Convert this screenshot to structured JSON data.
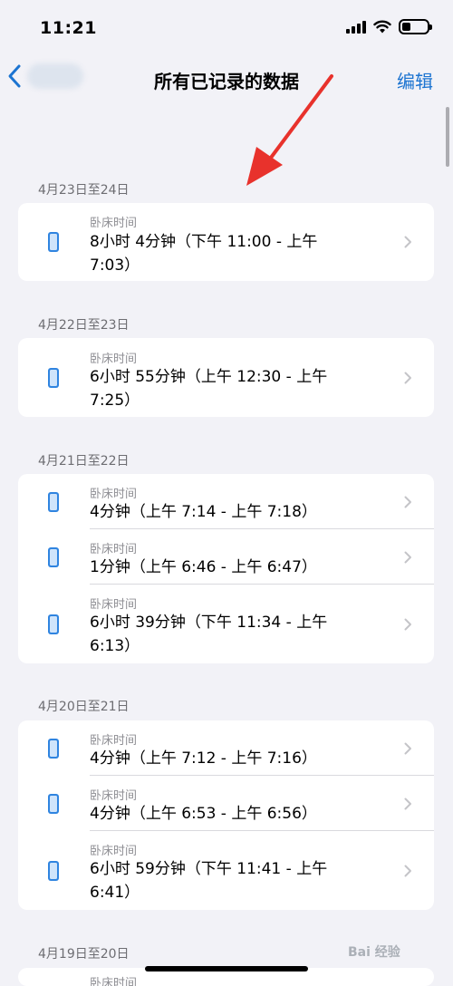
{
  "status_bar": {
    "time": "11:21",
    "battery_level": 0.35
  },
  "nav": {
    "title": "所有已记录的数据",
    "edit_label": "编辑"
  },
  "accent_color": "#1c74d1",
  "sections": [
    {
      "header": "4月23日至24日",
      "rows": [
        {
          "category": "卧床时间",
          "line1": "8小时 4分钟（下午 11:00 - 上午",
          "line2": "7:03）"
        }
      ]
    },
    {
      "header": "4月22日至23日",
      "rows": [
        {
          "category": "卧床时间",
          "line1": "6小时 55分钟（上午 12:30 - 上午",
          "line2": "7:25）"
        }
      ]
    },
    {
      "header": "4月21日至22日",
      "rows": [
        {
          "category": "卧床时间",
          "line1": "4分钟（上午 7:14 - 上午 7:18）"
        },
        {
          "category": "卧床时间",
          "line1": "1分钟（上午 6:46 - 上午 6:47）"
        },
        {
          "category": "卧床时间",
          "line1": "6小时 39分钟（下午 11:34 - 上午",
          "line2": "6:13）"
        }
      ]
    },
    {
      "header": "4月20日至21日",
      "rows": [
        {
          "category": "卧床时间",
          "line1": "4分钟（上午 7:12 - 上午 7:16）"
        },
        {
          "category": "卧床时间",
          "line1": "4分钟（上午 6:53 - 上午 6:56）"
        },
        {
          "category": "卧床时间",
          "line1": "6小时 59分钟（下午 11:41 - 上午",
          "line2": "6:41）"
        }
      ]
    },
    {
      "header": "4月19日至20日",
      "rows": [
        {
          "category": "卧床时间"
        }
      ]
    }
  ],
  "watermark": "Bai 经验"
}
